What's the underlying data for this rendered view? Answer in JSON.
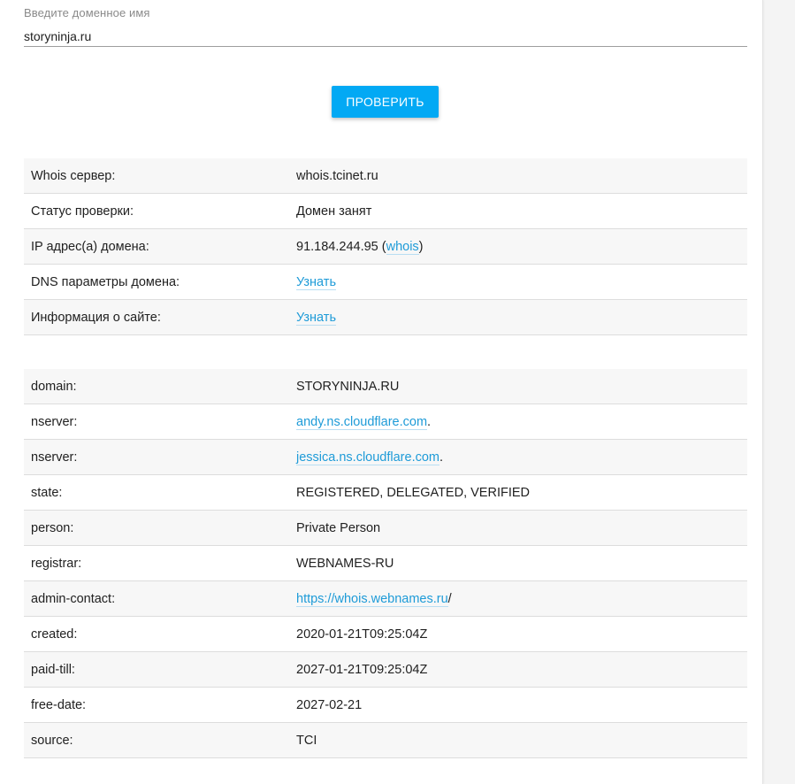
{
  "form": {
    "label": "Введите доменное имя",
    "value": "storyninja.ru",
    "button_label": "ПРОВЕРИТЬ"
  },
  "summary": {
    "whois_server": {
      "key": "Whois сервер:",
      "value": "whois.tcinet.ru"
    },
    "status": {
      "key": "Статус проверки:",
      "value": "Домен занят"
    },
    "ip": {
      "key": "IP адрес(а) домена:",
      "value": "91.184.244.95",
      "open": " (",
      "link": "whois",
      "close": ")"
    },
    "dns": {
      "key": "DNS параметры домена:",
      "link": "Узнать"
    },
    "site": {
      "key": "Информация о сайте:",
      "link": "Узнать"
    }
  },
  "whois": {
    "domain": {
      "key": "domain:",
      "value": "STORYNINJA.RU"
    },
    "nserver1": {
      "key": "nserver:",
      "link": "andy.ns.cloudflare.com",
      "suffix": "."
    },
    "nserver2": {
      "key": "nserver:",
      "link": "jessica.ns.cloudflare.com",
      "suffix": "."
    },
    "state": {
      "key": "state:",
      "value": "REGISTERED, DELEGATED, VERIFIED"
    },
    "person": {
      "key": "person:",
      "value": "Private Person"
    },
    "registrar": {
      "key": "registrar:",
      "value": "WEBNAMES-RU"
    },
    "admin_contact": {
      "key": "admin-contact:",
      "link": "https://whois.webnames.ru",
      "suffix": "/"
    },
    "created": {
      "key": "created:",
      "value": "2020-01-21T09:25:04Z"
    },
    "paid_till": {
      "key": "paid-till:",
      "value": "2027-01-21T09:25:04Z"
    },
    "free_date": {
      "key": "free-date:",
      "value": "2027-02-21"
    },
    "source": {
      "key": "source:",
      "value": "TCI"
    }
  },
  "colors": {
    "accent": "#03a9f4",
    "link": "#1e9bd8",
    "row_alt": "#f7f7f7"
  }
}
